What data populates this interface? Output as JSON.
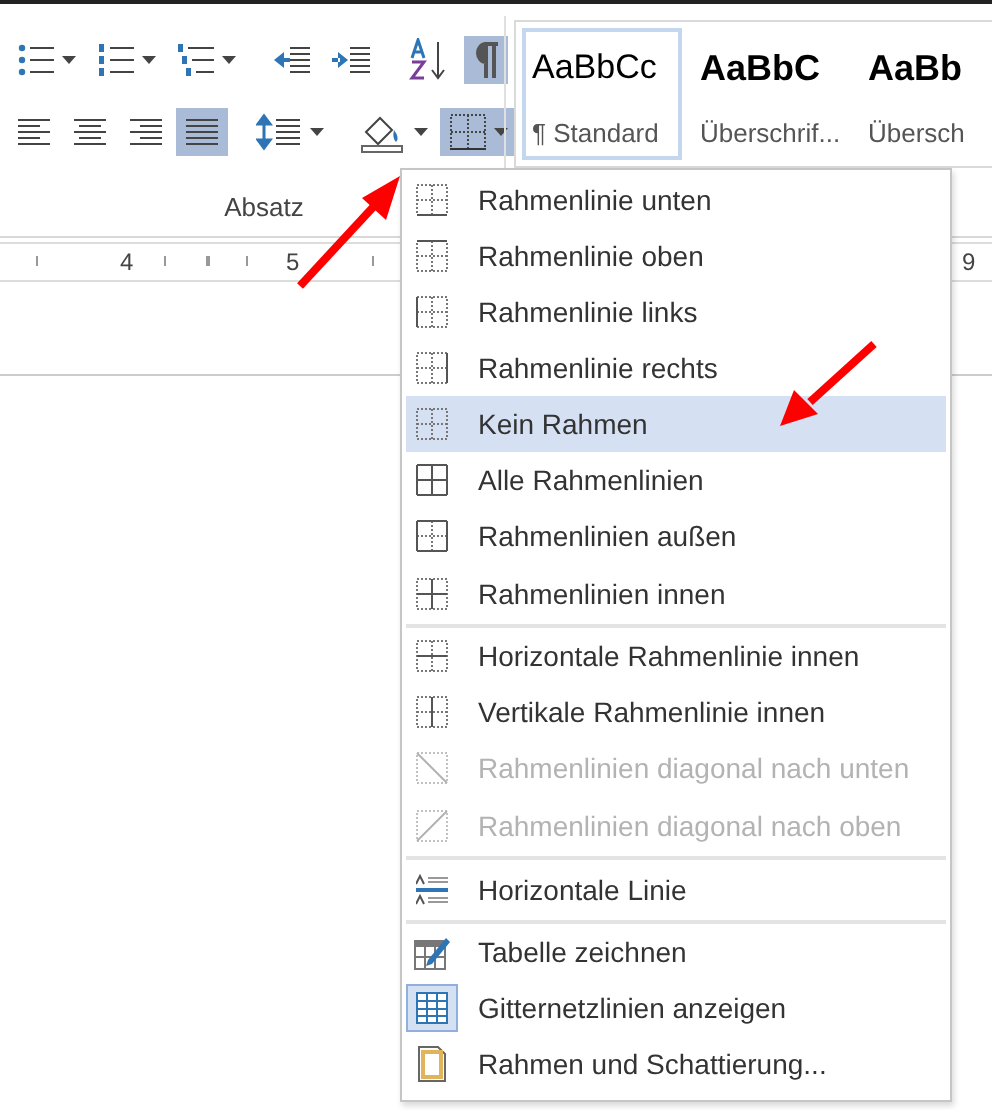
{
  "ribbon": {
    "row_1": [
      {
        "kind": "bullets",
        "selected": false,
        "dropdown": true
      },
      {
        "kind": "numbering",
        "selected": false,
        "dropdown": true
      },
      {
        "kind": "multilevel",
        "selected": false,
        "dropdown": true
      },
      {
        "kind": "sep"
      },
      {
        "kind": "indent-less",
        "selected": false,
        "dropdown": false
      },
      {
        "kind": "indent-more",
        "selected": false,
        "dropdown": false
      },
      {
        "kind": "sep"
      },
      {
        "kind": "sort",
        "selected": false,
        "dropdown": false
      },
      {
        "kind": "pilcrow",
        "selected": true,
        "dropdown": false
      }
    ],
    "row_2": [
      {
        "kind": "align-left",
        "selected": false,
        "dropdown": false
      },
      {
        "kind": "align-center",
        "selected": false,
        "dropdown": false
      },
      {
        "kind": "align-right",
        "selected": false,
        "dropdown": false
      },
      {
        "kind": "justify",
        "selected": true,
        "dropdown": false
      },
      {
        "kind": "sep"
      },
      {
        "kind": "line-spacing",
        "selected": false,
        "dropdown": true
      },
      {
        "kind": "sep"
      },
      {
        "kind": "shading",
        "selected": false,
        "dropdown": true
      },
      {
        "kind": "borders",
        "selected": true,
        "dropdown": true
      }
    ],
    "group_label": "Absatz",
    "styles": [
      {
        "preview": "AaBbCc",
        "name": "¶ Standard",
        "kind": "normal",
        "selected": true
      },
      {
        "preview": "AaBbC",
        "name": "Überschrif...",
        "kind": "heading",
        "selected": false
      },
      {
        "preview": "AaBb",
        "name": "Übersch",
        "kind": "heading",
        "selected": false
      }
    ]
  },
  "ruler": {
    "numbers": [
      "4",
      "5",
      "9"
    ]
  },
  "menu": {
    "items": [
      {
        "label": "Rahmenlinie unten",
        "kind": "bottom",
        "selected": false,
        "disabled": false,
        "checked": false
      },
      {
        "label": "Rahmenlinie oben",
        "kind": "top",
        "selected": false,
        "disabled": false,
        "checked": false
      },
      {
        "label": "Rahmenlinie links",
        "kind": "left",
        "selected": false,
        "disabled": false,
        "checked": false
      },
      {
        "label": "Rahmenlinie rechts",
        "kind": "right",
        "selected": false,
        "disabled": false,
        "checked": false
      },
      {
        "label": "Kein Rahmen",
        "kind": "none",
        "selected": true,
        "disabled": false,
        "checked": false
      },
      {
        "label": "Alle Rahmenlinien",
        "kind": "all",
        "selected": false,
        "disabled": false,
        "checked": false
      },
      {
        "label": "Rahmenlinien außen",
        "kind": "outside",
        "selected": false,
        "disabled": false,
        "checked": false
      },
      {
        "label": "Rahmenlinien innen",
        "kind": "inside",
        "selected": false,
        "disabled": false,
        "checked": false,
        "separator_after": true
      },
      {
        "label": "Horizontale Rahmenlinie innen",
        "kind": "inside-h",
        "selected": false,
        "disabled": false,
        "checked": false
      },
      {
        "label": "Vertikale Rahmenlinie innen",
        "kind": "inside-v",
        "selected": false,
        "disabled": false,
        "checked": false
      },
      {
        "label": "Rahmenlinien diagonal nach unten",
        "kind": "diag-down",
        "selected": false,
        "disabled": true,
        "checked": false
      },
      {
        "label": "Rahmenlinien diagonal nach oben",
        "kind": "diag-up",
        "selected": false,
        "disabled": true,
        "checked": false,
        "separator_after": true
      },
      {
        "label": "Horizontale Linie",
        "kind": "hline",
        "selected": false,
        "disabled": false,
        "checked": false,
        "separator_after": true
      },
      {
        "label": "Tabelle zeichnen",
        "kind": "draw-table",
        "selected": false,
        "disabled": false,
        "checked": false
      },
      {
        "label": "Gitternetzlinien anzeigen",
        "kind": "gridlines",
        "selected": false,
        "disabled": false,
        "checked": true
      },
      {
        "label": "Rahmen und Schattierung...",
        "kind": "dialog",
        "selected": false,
        "disabled": false,
        "checked": false
      }
    ]
  }
}
